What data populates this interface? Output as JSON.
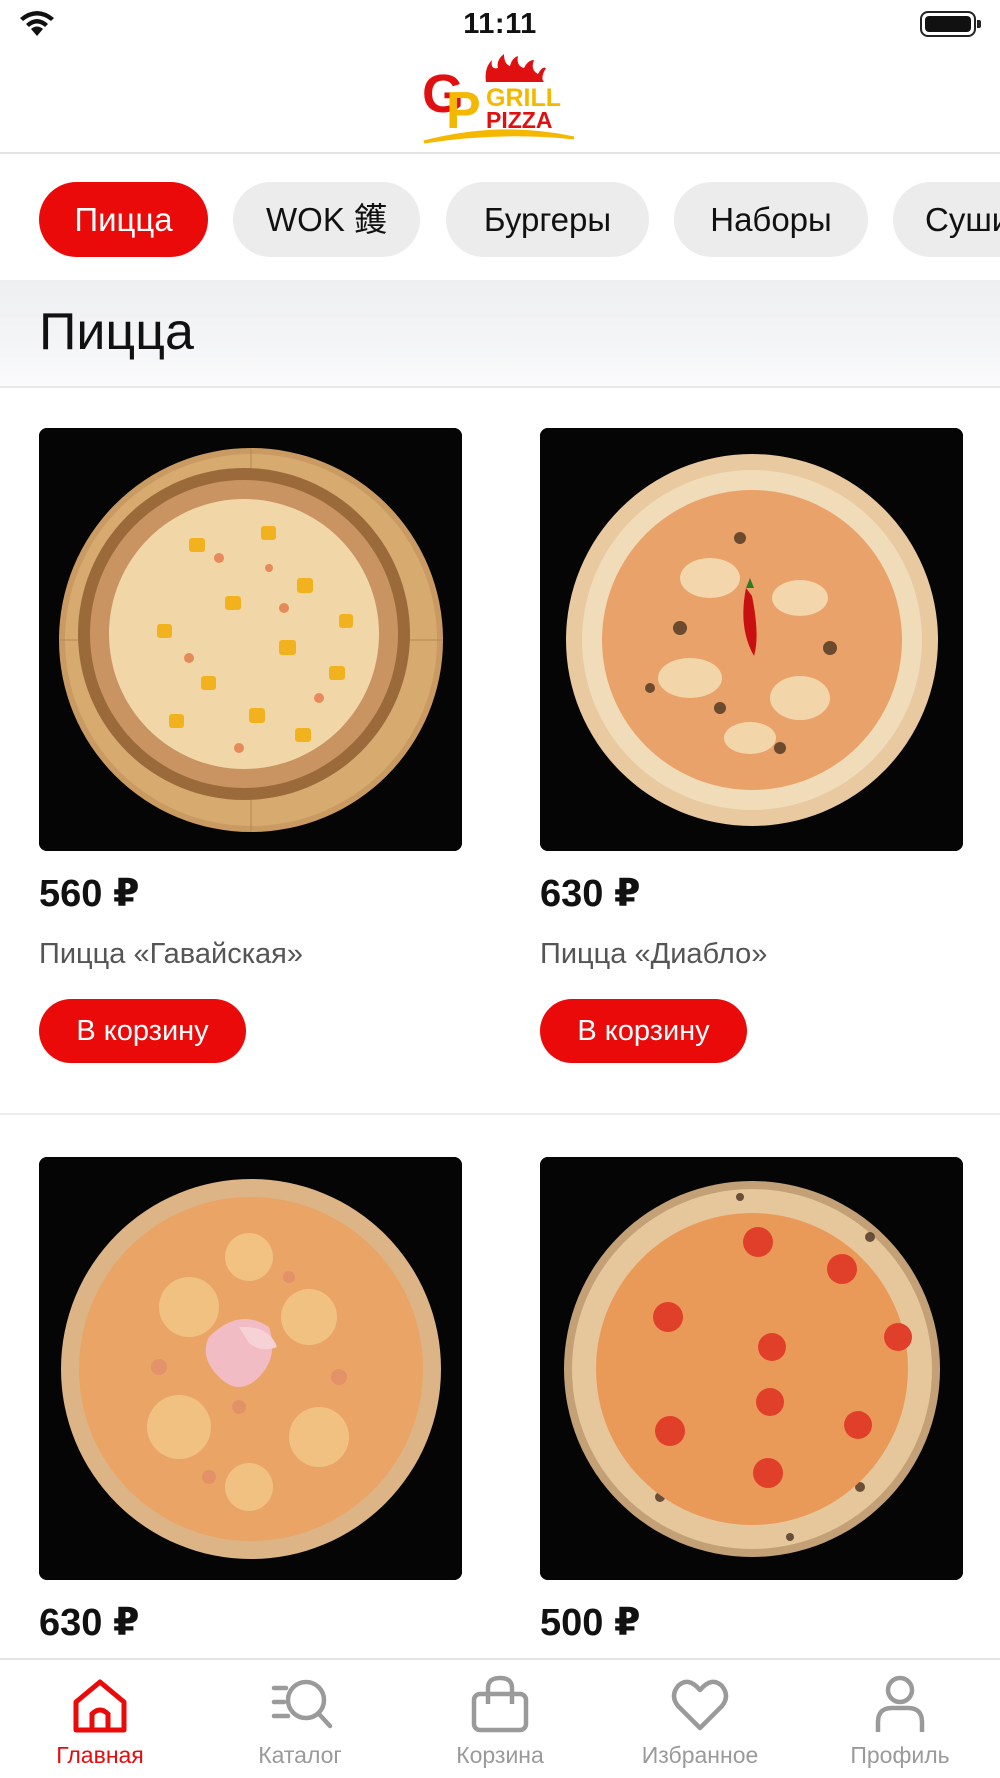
{
  "status_bar": {
    "time": "11:11"
  },
  "brand": {
    "line1": "GRILL",
    "line2": "PIZZA",
    "monogram": "GP",
    "colors": {
      "red": "#e01010",
      "yellow": "#f5b800"
    }
  },
  "categories": [
    {
      "label": "Пицца",
      "active": true
    },
    {
      "label": "WOK 鑊",
      "active": false
    },
    {
      "label": "Бургеры",
      "active": false
    },
    {
      "label": "Наборы",
      "active": false
    },
    {
      "label": "Суши",
      "active": false
    }
  ],
  "section": {
    "title": "Пицца"
  },
  "products": [
    {
      "price": "560 ₽",
      "name": "Пицца «Гавайская»",
      "button": "В корзину"
    },
    {
      "price": "630 ₽",
      "name": "Пицца «Диабло»",
      "button": "В корзину"
    },
    {
      "price": "630 ₽",
      "name": "",
      "button": ""
    },
    {
      "price": "500 ₽",
      "name": "",
      "button": ""
    }
  ],
  "bottom_nav": [
    {
      "label": "Главная",
      "icon": "home-icon",
      "active": true
    },
    {
      "label": "Каталог",
      "icon": "catalog-search-icon",
      "active": false
    },
    {
      "label": "Корзина",
      "icon": "shopping-bag-icon",
      "active": false
    },
    {
      "label": "Избранное",
      "icon": "heart-icon",
      "active": false
    },
    {
      "label": "Профиль",
      "icon": "profile-icon",
      "active": false
    }
  ],
  "colors": {
    "accent": "#ea0a0a",
    "chip_bg": "#ececec",
    "inactive_nav": "#9a9a9a"
  }
}
